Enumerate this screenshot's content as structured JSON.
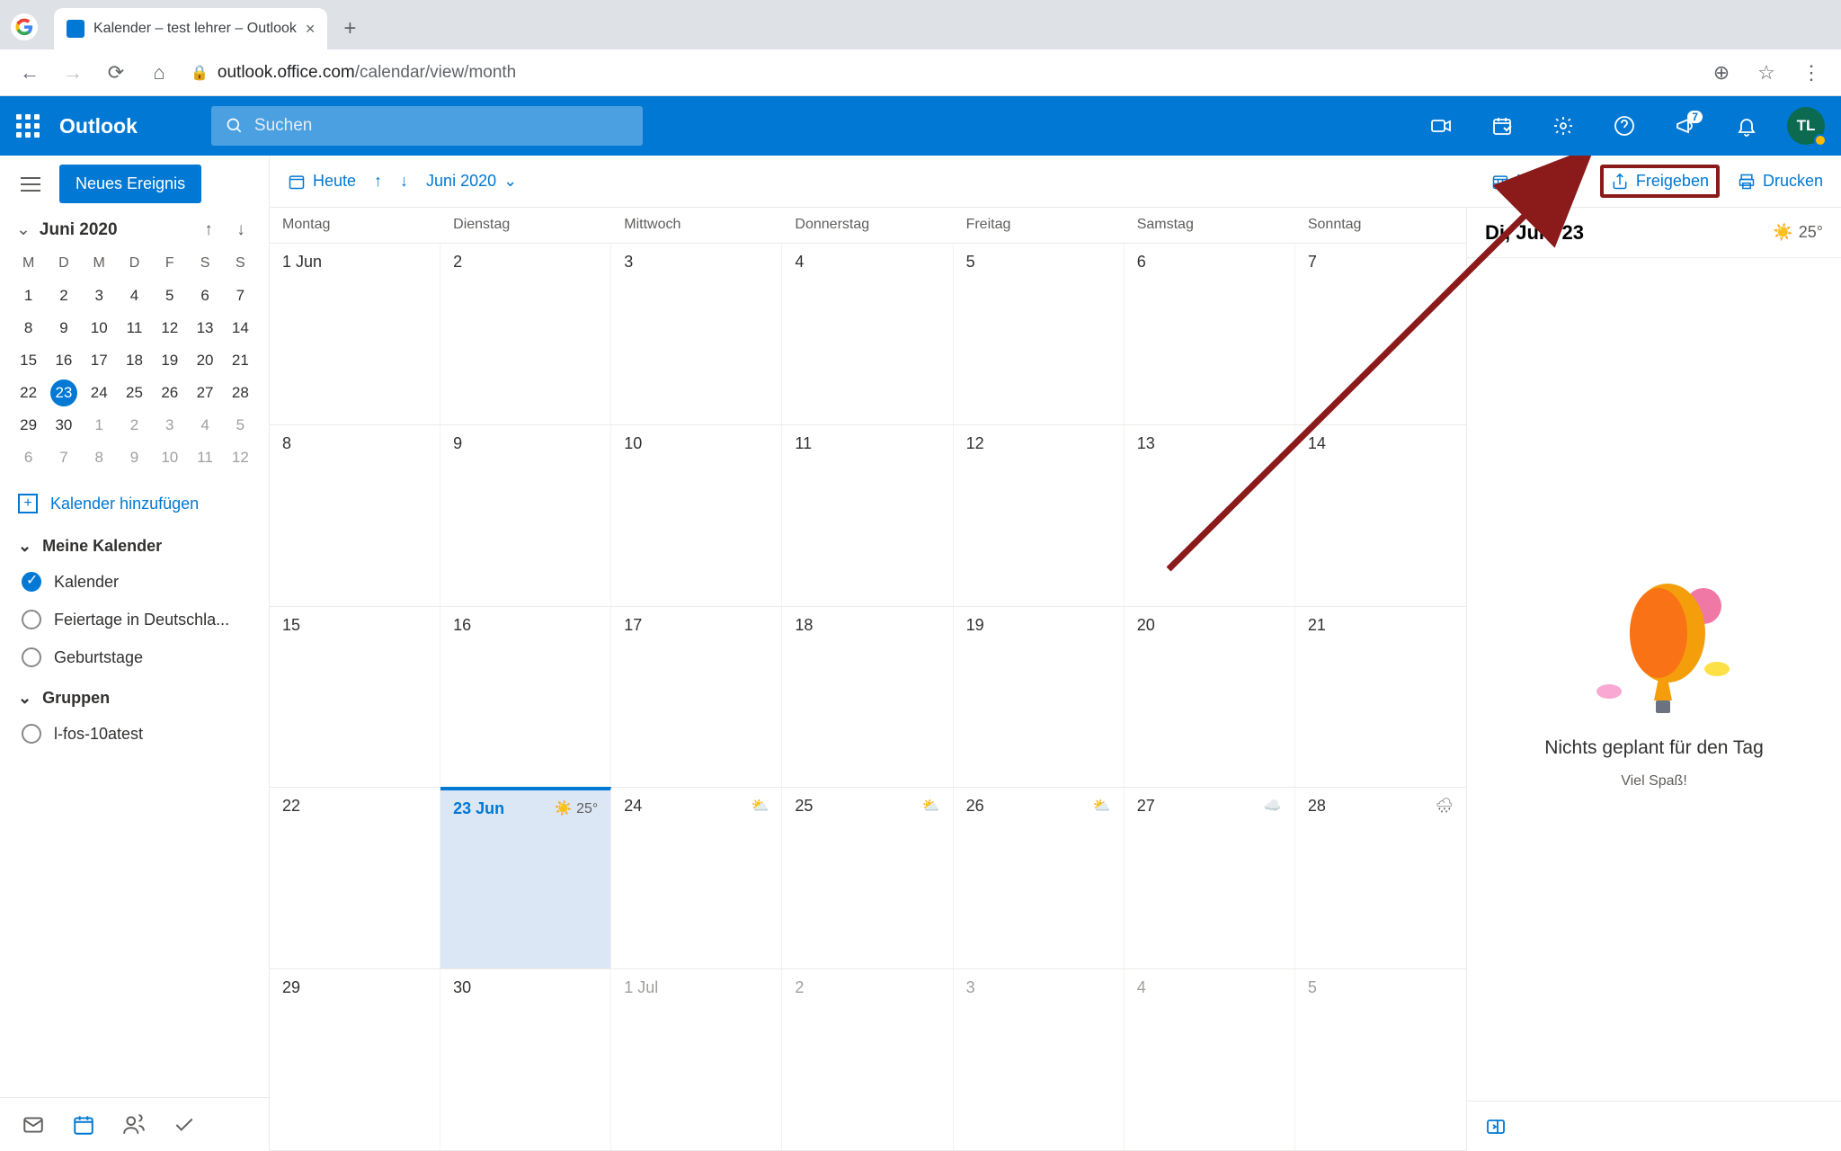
{
  "browser": {
    "tab_title": "Kalender – test lehrer – Outlook",
    "url_host": "outlook.office.com",
    "url_path": "/calendar/view/month"
  },
  "header": {
    "brand": "Outlook",
    "search_placeholder": "Suchen",
    "badge": "7",
    "avatar_initials": "TL"
  },
  "sidebar": {
    "new_event": "Neues Ereignis",
    "mini_title": "Juni 2020",
    "weekday_labels": [
      "M",
      "D",
      "M",
      "D",
      "F",
      "S",
      "S"
    ],
    "mini_weeks": [
      [
        "1",
        "2",
        "3",
        "4",
        "5",
        "6",
        "7"
      ],
      [
        "8",
        "9",
        "10",
        "11",
        "12",
        "13",
        "14"
      ],
      [
        "15",
        "16",
        "17",
        "18",
        "19",
        "20",
        "21"
      ],
      [
        "22",
        "23",
        "24",
        "25",
        "26",
        "27",
        "28"
      ],
      [
        "29",
        "30",
        "1",
        "2",
        "3",
        "4",
        "5"
      ],
      [
        "6",
        "7",
        "8",
        "9",
        "10",
        "11",
        "12"
      ]
    ],
    "mini_today": "23",
    "add_calendar": "Kalender hinzufügen",
    "section_my": "Meine Kalender",
    "my_items": [
      {
        "label": "Kalender",
        "checked": true
      },
      {
        "label": "Feiertage in Deutschla...",
        "checked": false
      },
      {
        "label": "Geburtstage",
        "checked": false
      }
    ],
    "section_groups": "Gruppen",
    "group_items": [
      {
        "label": "l-fos-10atest",
        "checked": false
      }
    ]
  },
  "toolbar": {
    "today": "Heute",
    "month_label": "Juni 2020",
    "view_label": "Monat",
    "share": "Freigeben",
    "print": "Drucken"
  },
  "calendar": {
    "day_headers": [
      "Montag",
      "Dienstag",
      "Mittwoch",
      "Donnerstag",
      "Freitag",
      "Samstag",
      "Sonntag"
    ],
    "weeks": [
      [
        {
          "d": "1 Jun"
        },
        {
          "d": "2"
        },
        {
          "d": "3"
        },
        {
          "d": "4"
        },
        {
          "d": "5"
        },
        {
          "d": "6"
        },
        {
          "d": "7"
        }
      ],
      [
        {
          "d": "8"
        },
        {
          "d": "9"
        },
        {
          "d": "10"
        },
        {
          "d": "11"
        },
        {
          "d": "12"
        },
        {
          "d": "13"
        },
        {
          "d": "14"
        }
      ],
      [
        {
          "d": "15"
        },
        {
          "d": "16"
        },
        {
          "d": "17"
        },
        {
          "d": "18"
        },
        {
          "d": "19"
        },
        {
          "d": "20"
        },
        {
          "d": "21"
        }
      ],
      [
        {
          "d": "22"
        },
        {
          "d": "23 Jun",
          "today": true,
          "w": "25°",
          "wi": "sun"
        },
        {
          "d": "24",
          "w": "",
          "wi": "cloud"
        },
        {
          "d": "25",
          "w": "",
          "wi": "cloud"
        },
        {
          "d": "26",
          "w": "",
          "wi": "cloud"
        },
        {
          "d": "27",
          "w": "",
          "wi": "clouds"
        },
        {
          "d": "28",
          "w": "",
          "wi": "rain"
        }
      ],
      [
        {
          "d": "29"
        },
        {
          "d": "30"
        },
        {
          "d": "1 Jul",
          "dim": true
        },
        {
          "d": "2",
          "dim": true
        },
        {
          "d": "3",
          "dim": true
        },
        {
          "d": "4",
          "dim": true
        },
        {
          "d": "5",
          "dim": true
        }
      ]
    ]
  },
  "right": {
    "date": "Di, Jun. 23",
    "temp": "25°",
    "empty_title": "Nichts geplant für den Tag",
    "empty_sub": "Viel Spaß!"
  }
}
